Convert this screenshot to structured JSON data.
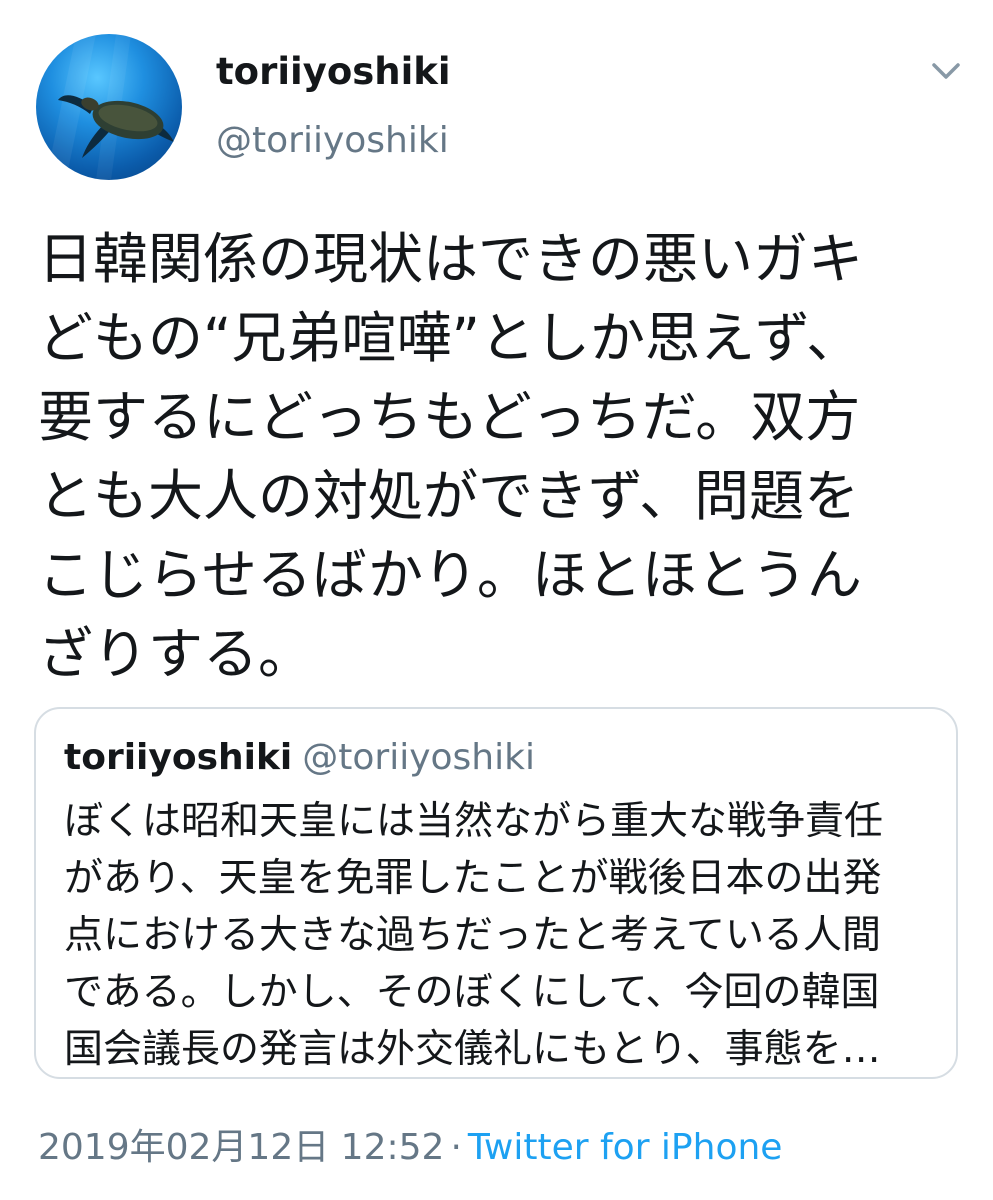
{
  "author": {
    "display_name": "toriiyoshiki",
    "handle": "@toriiyoshiki"
  },
  "tweet": {
    "lines": [
      "日韓関係の現状はできの悪いガキ",
      "どもの“兄弟喧嘩”としか思えず、",
      "要するにどっちもどっちだ。双方",
      "とも大人の対処ができず、問題を",
      "こじらせるばかり。ほとほとうん",
      "ざりする。"
    ]
  },
  "quoted_tweet": {
    "display_name": "toriiyoshiki",
    "handle": "@toriiyoshiki",
    "lines": [
      "ぼくは昭和天皇には当然ながら重大な戦争責任",
      "があり、天皇を免罪したことが戦後日本の出発",
      "点における大きな過ちだったと考えている人間",
      "である。しかし、そのぼくにして、今回の韓国",
      "国会議長の発言は外交儀礼にもとり、事態を…"
    ]
  },
  "meta": {
    "timestamp": "2019年02月12日 12:52",
    "separator": "·",
    "source": "Twitter for iPhone"
  },
  "icons": {
    "avatar": "sea-turtle-avatar",
    "menu": "chevron-down-icon"
  },
  "colors": {
    "text": "#14171a",
    "secondary": "#657786",
    "link": "#1da1f2",
    "border": "#d6dde3"
  }
}
